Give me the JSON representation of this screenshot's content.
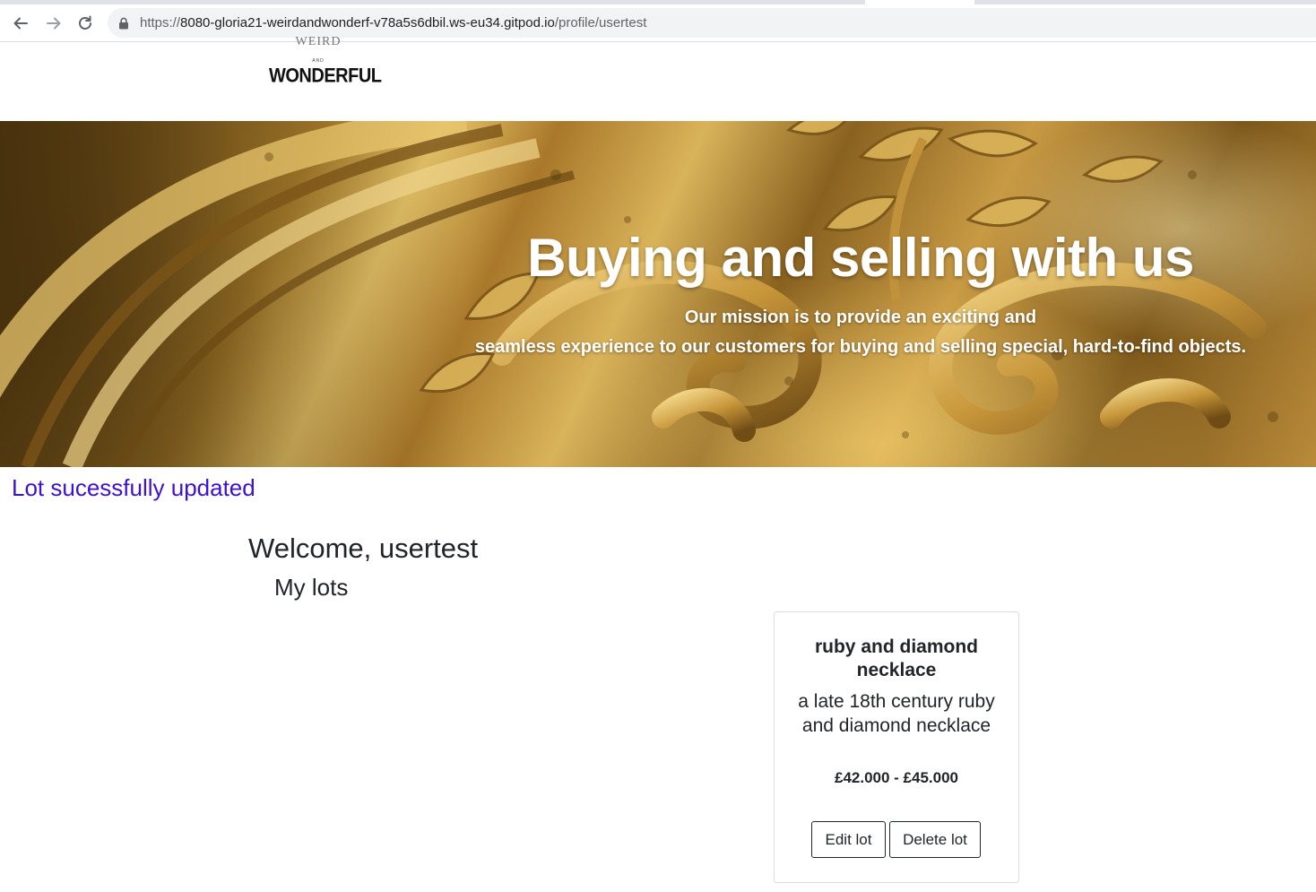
{
  "browser": {
    "url_scheme": "https://",
    "url_host": "8080-gloria21-weirdandwonderf-v78a5s6dbil.ws-eu34.gitpod.io",
    "url_path": "/profile/usertest"
  },
  "logo": {
    "top_partial": "WEIRD",
    "and": "AND",
    "wordmark": "WONDERFUL"
  },
  "hero": {
    "title": "Buying and selling with us",
    "subtitle_line1": "Our mission is to provide an exciting and",
    "subtitle_line2": "seamless experience to our customers for buying and selling special, hard-to-find objects."
  },
  "flash": {
    "message": "Lot sucessfully updated",
    "color": "#3d10d6"
  },
  "profile": {
    "welcome": "Welcome, usertest",
    "section_title": "My lots"
  },
  "lots": [
    {
      "title": "ruby and diamond necklace",
      "description": "a late 18th century ruby and diamond necklace",
      "price": "£42.000 - £45.000",
      "edit_label": "Edit lot",
      "delete_label": "Delete lot"
    }
  ]
}
